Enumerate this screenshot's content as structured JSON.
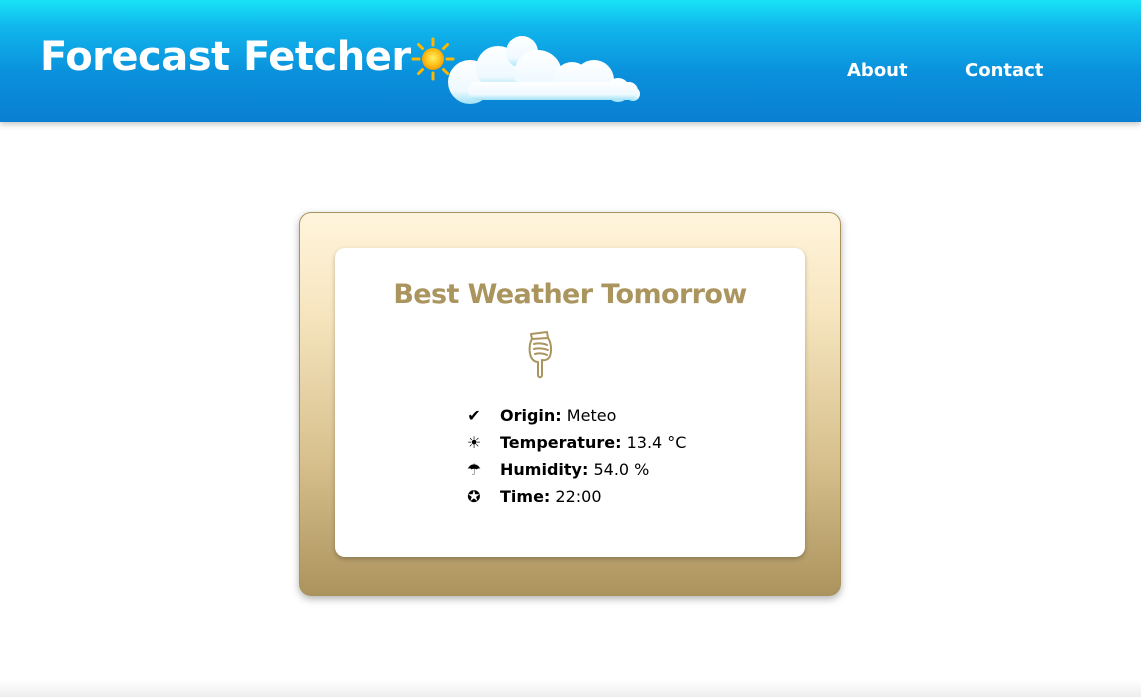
{
  "header": {
    "title": "Forecast Fetcher",
    "nav": [
      {
        "label": "About"
      },
      {
        "label": "Contact"
      }
    ],
    "icons": [
      "sun-icon",
      "clouds-icon"
    ],
    "colors": {
      "bar_top": "#19e3f7",
      "bar_bottom": "#0b7fd2",
      "text": "#ffffff"
    }
  },
  "card": {
    "title": "Best Weather Tomorrow",
    "pointer_icon": "pointing-down-hand-icon",
    "colors": {
      "accent": "#ab955f",
      "frame_top": "#fff4dc",
      "frame_bottom": "#ac935e"
    },
    "rows": [
      {
        "icon": "✔",
        "icon_name": "checkmark-icon",
        "label": "Origin:",
        "value": "Meteo"
      },
      {
        "icon": "☀",
        "icon_name": "sun-icon",
        "label": "Temperature:",
        "value": "13.4 °C"
      },
      {
        "icon": "☂",
        "icon_name": "umbrella-icon",
        "label": "Humidity:",
        "value": "54.0 %"
      },
      {
        "icon": "✪",
        "icon_name": "clock-icon",
        "label": "Time:",
        "value": "22:00"
      }
    ]
  }
}
